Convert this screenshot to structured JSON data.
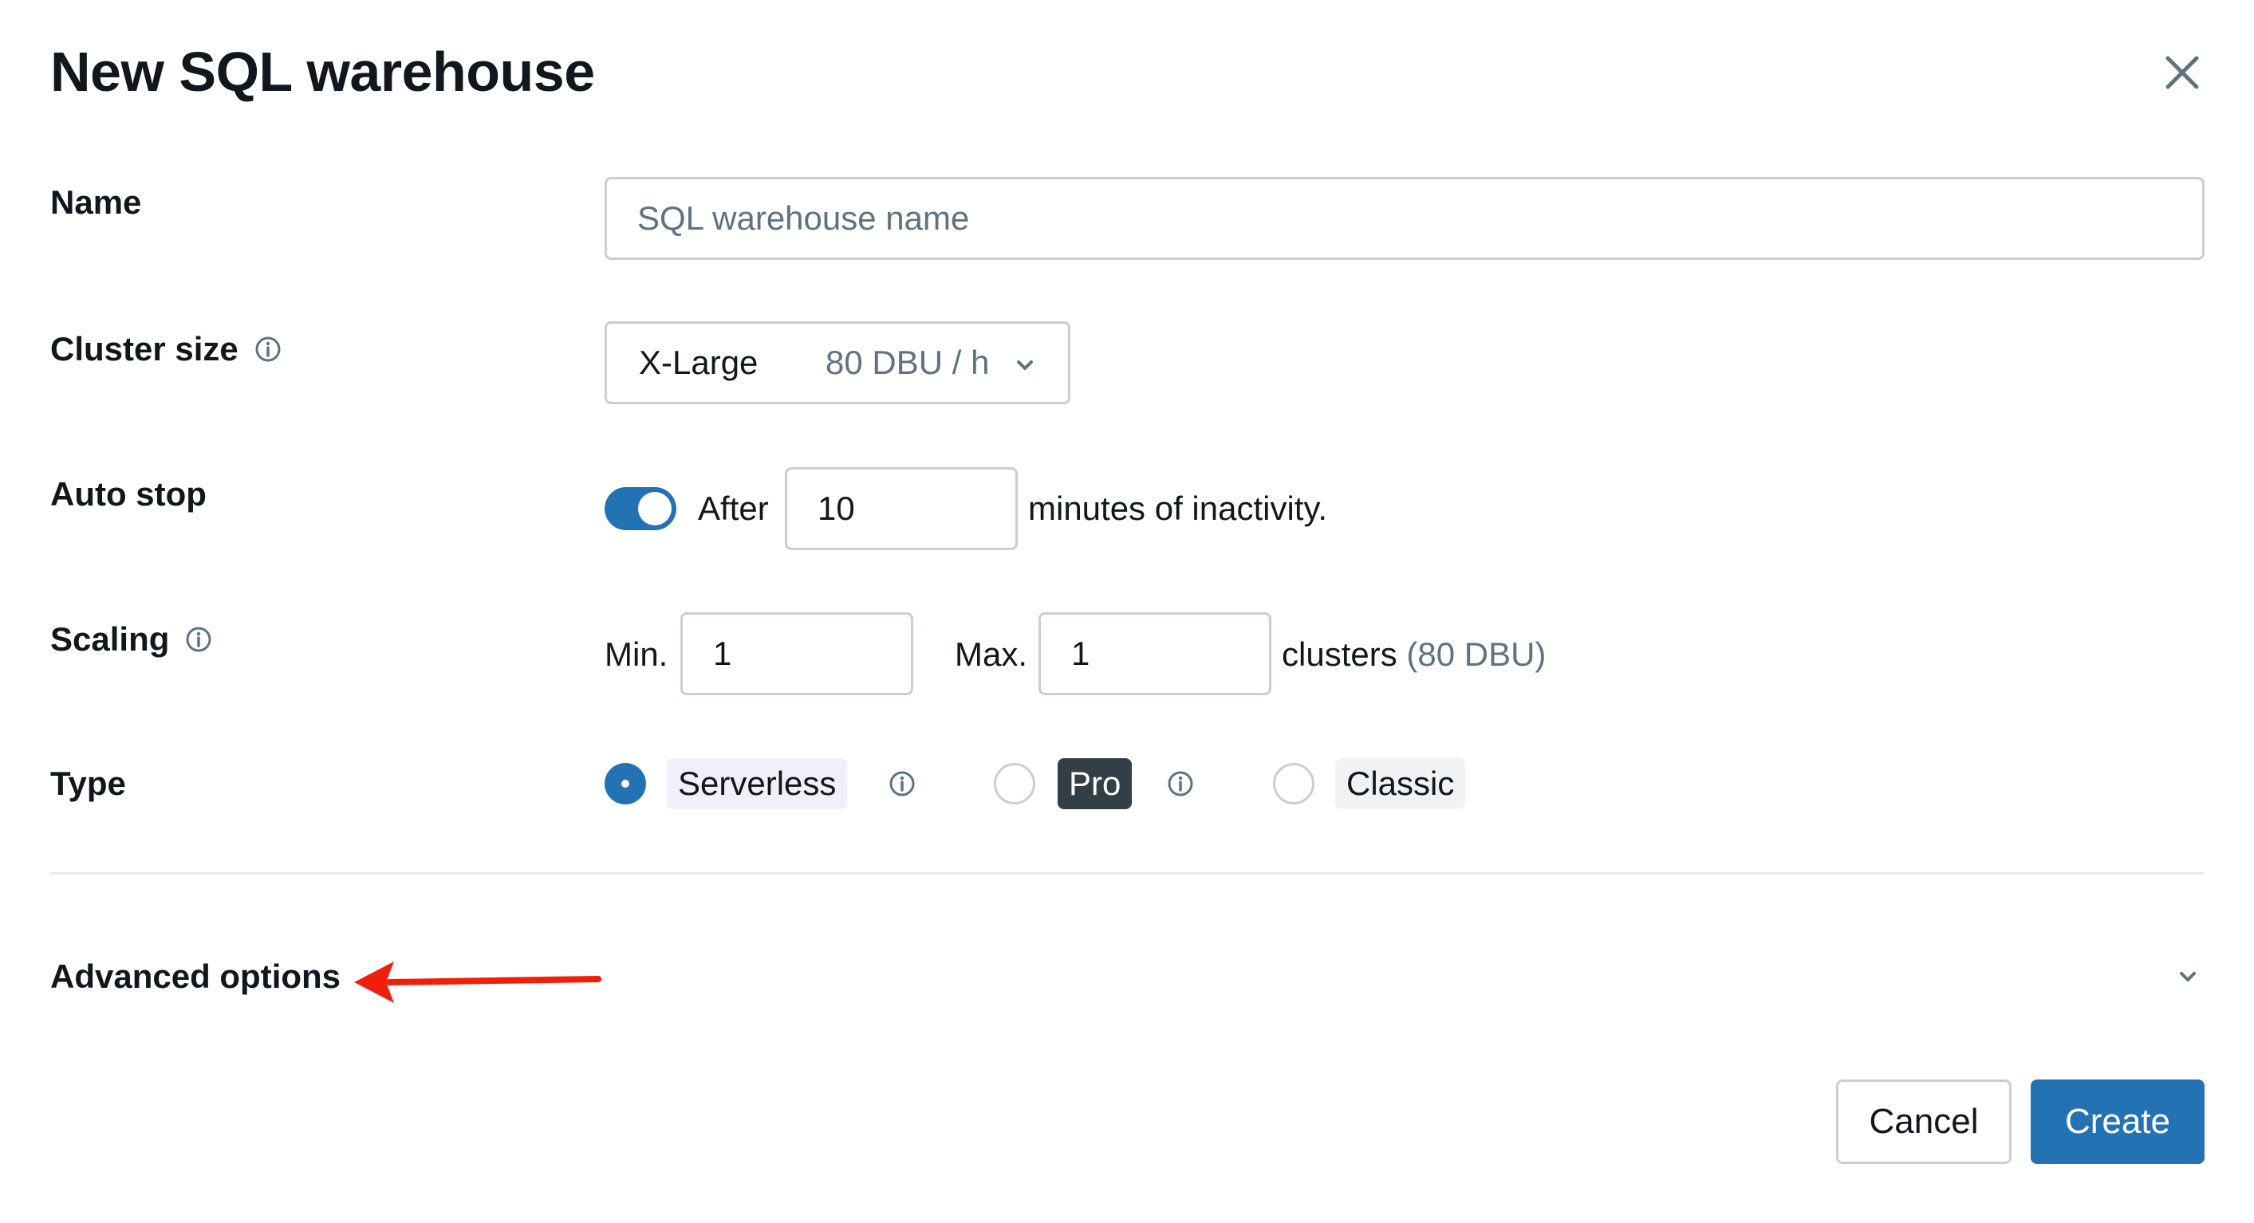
{
  "dialog": {
    "title": "New SQL warehouse",
    "close_icon": "close-icon"
  },
  "form": {
    "name": {
      "label": "Name",
      "value": "",
      "placeholder": "SQL warehouse name"
    },
    "cluster_size": {
      "label": "Cluster size",
      "selected_size": "X-Large",
      "selected_dbu": "80 DBU / h"
    },
    "auto_stop": {
      "label": "Auto stop",
      "enabled": true,
      "prefix": "After",
      "minutes": "10",
      "suffix": "minutes of inactivity."
    },
    "scaling": {
      "label": "Scaling",
      "min_label": "Min.",
      "min_value": "1",
      "max_label": "Max.",
      "max_value": "1",
      "clusters_label": "clusters",
      "dbu_note": "(80 DBU)"
    },
    "type": {
      "label": "Type",
      "options": [
        {
          "label": "Serverless",
          "selected": true
        },
        {
          "label": "Pro",
          "selected": false
        },
        {
          "label": "Classic",
          "selected": false
        }
      ]
    }
  },
  "advanced": {
    "label": "Advanced options",
    "expanded": false
  },
  "annotation": {
    "arrow_color": "#f01f09"
  },
  "footer": {
    "cancel_label": "Cancel",
    "create_label": "Create"
  },
  "colors": {
    "primary": "#2272b4",
    "border": "#c7ced4",
    "muted_text": "#5f7281",
    "serverless_tag_bg": "#f2effa",
    "pro_tag_bg": "#333e47",
    "classic_tag_bg": "#f0f2f4"
  }
}
